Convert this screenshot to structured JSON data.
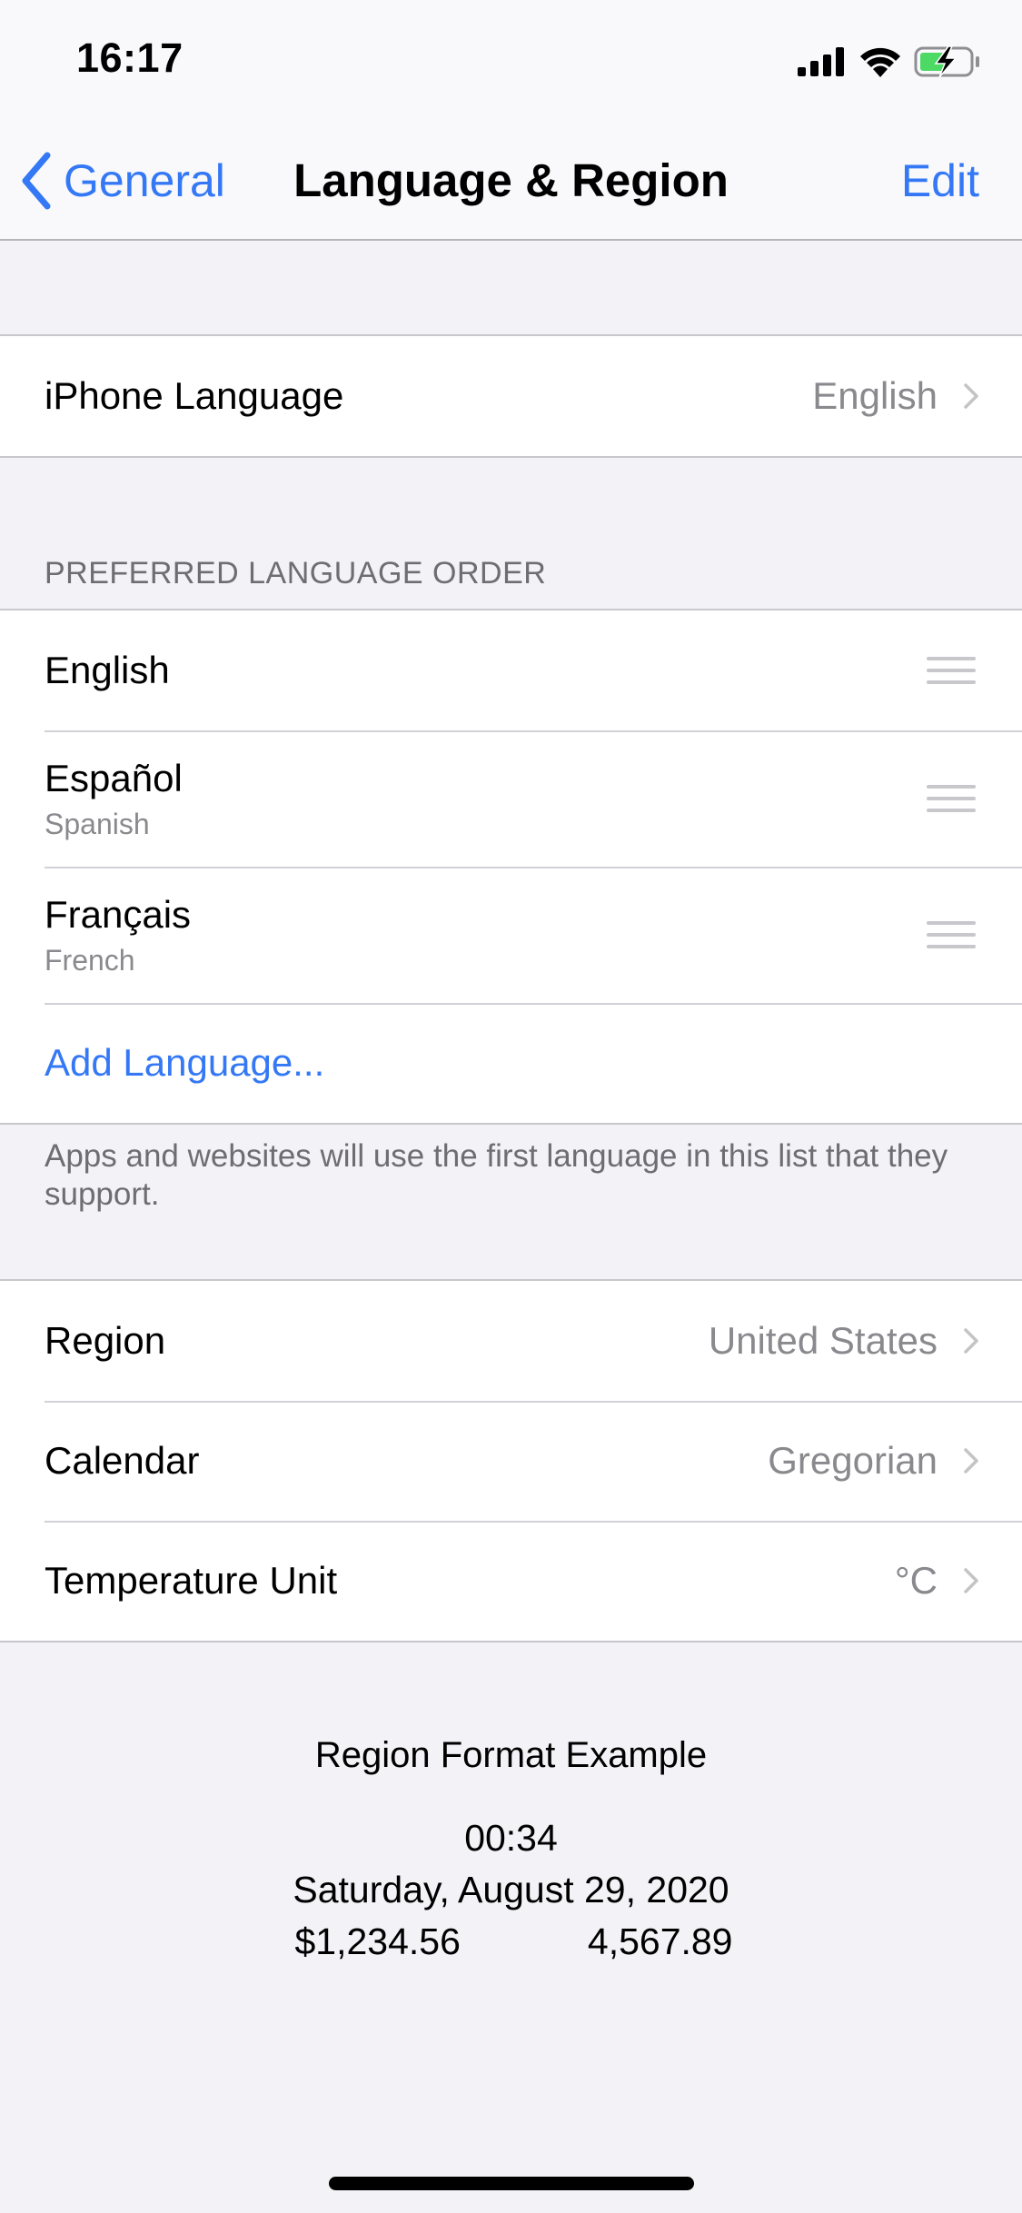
{
  "status_bar": {
    "time": "16:17",
    "icons": [
      "cellular-signal-icon",
      "wifi-icon",
      "battery-charging-icon"
    ],
    "battery_color": "#4cd964"
  },
  "nav": {
    "back_label": "General",
    "title": "Language & Region",
    "edit_label": "Edit",
    "accent_color": "#3478f6"
  },
  "iphone_language": {
    "label": "iPhone Language",
    "value": "English"
  },
  "preferred_languages": {
    "header": "PREFERRED LANGUAGE ORDER",
    "items": [
      {
        "name": "English",
        "subtitle": ""
      },
      {
        "name": "Español",
        "subtitle": "Spanish"
      },
      {
        "name": "Français",
        "subtitle": "French"
      }
    ],
    "add_label": "Add Language...",
    "footer": "Apps and websites will use the first language in this list that they support."
  },
  "region_settings": [
    {
      "label": "Region",
      "value": "United States"
    },
    {
      "label": "Calendar",
      "value": "Gregorian"
    },
    {
      "label": "Temperature Unit",
      "value": "°C"
    }
  ],
  "region_example": {
    "title": "Region Format Example",
    "time": "00:34",
    "date": "Saturday, August 29, 2020",
    "currency": "$1,234.56",
    "number": "4,567.89"
  }
}
